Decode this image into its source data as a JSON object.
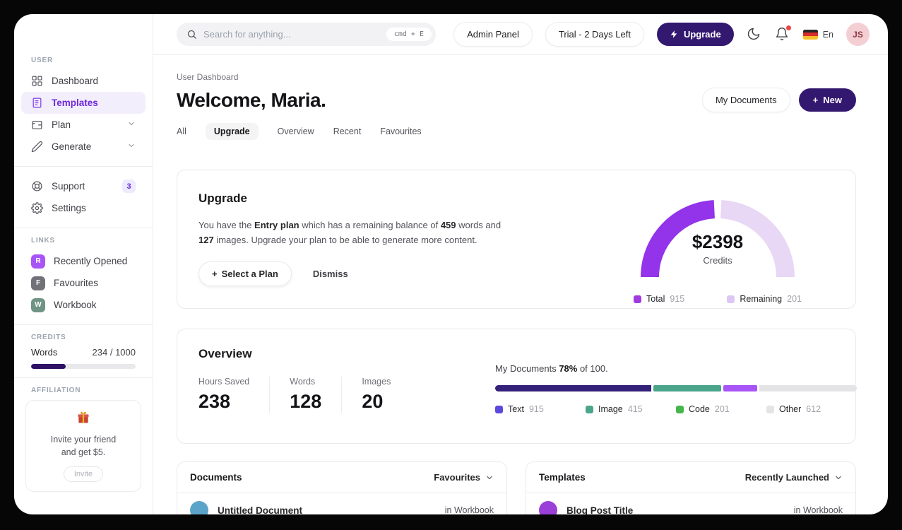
{
  "sidebar": {
    "section_labels": {
      "user": "USER",
      "links": "LINKS",
      "credits": "CREDITS",
      "affiliation": "AFFILIATION"
    },
    "nav": [
      {
        "label": "Dashboard",
        "icon": "dashboard-grid-icon",
        "active": false
      },
      {
        "label": "Templates",
        "icon": "templates-doc-icon",
        "active": true
      },
      {
        "label": "Plan",
        "icon": "wallet-icon",
        "expandable": true
      },
      {
        "label": "Generate",
        "icon": "pencil-icon",
        "expandable": true
      }
    ],
    "secondary": [
      {
        "label": "Support",
        "icon": "lifebuoy-icon",
        "badge": "3"
      },
      {
        "label": "Settings",
        "icon": "gear-icon"
      }
    ],
    "links": [
      {
        "initial": "R",
        "label": "Recently Opened",
        "color": "#a855f7"
      },
      {
        "initial": "F",
        "label": "Favourites",
        "color": "#71717a"
      },
      {
        "initial": "W",
        "label": "Workbook",
        "color": "#6f9486"
      }
    ],
    "credits": {
      "label": "Words",
      "value": "234 / 1000",
      "fill_width": "33%",
      "fill_color": "#2e1065"
    },
    "affiliation": {
      "icon": "gift-icon",
      "text_line1": "Invite your friend",
      "text_line2": "and get $5.",
      "button": "Invite"
    }
  },
  "topbar": {
    "search": {
      "placeholder": "Search for anything...",
      "shortcut": "cmd + E",
      "icon": "search-icon"
    },
    "admin_button": "Admin Panel",
    "trial_button": "Trial - 2 Days Left",
    "upgrade_button": {
      "label": "Upgrade",
      "icon": "lightning-icon",
      "bg": "#331870"
    },
    "dark_mode_icon": "moon-icon",
    "notifications_icon": "bell-icon",
    "notification_dot_color": "#ef4444",
    "language": {
      "label": "En",
      "flag": "german-flag-icon",
      "flag_colors": [
        "#262626",
        "#d92c2c",
        "#f7bf2a"
      ]
    },
    "avatar": {
      "initials": "JS",
      "bg": "#f3cfd3",
      "fg": "#8c3a44"
    }
  },
  "header": {
    "breadcrumb": "User Dashboard",
    "title": "Welcome, Maria.",
    "my_documents_button": "My Documents",
    "new_button": {
      "plus": "+",
      "label": "New",
      "bg": "#331870"
    },
    "tabs": [
      {
        "label": "All",
        "active": false
      },
      {
        "label": "Upgrade",
        "active": true
      },
      {
        "label": "Overview",
        "active": false
      },
      {
        "label": "Recent",
        "active": false
      },
      {
        "label": "Favourites",
        "active": false
      }
    ]
  },
  "upgrade_card": {
    "title": "Upgrade",
    "body": [
      {
        "text": "You have the "
      },
      {
        "text": "Entry plan",
        "bold": true
      },
      {
        "text": " which has a remaining balance of "
      },
      {
        "text": "459",
        "bold": true
      },
      {
        "text": " words and "
      },
      {
        "text": "127",
        "bold": true
      },
      {
        "text": " images. Upgrade your plan to be able to generate more content."
      }
    ],
    "select_plan_button": {
      "plus": "+",
      "label": "Select a Plan"
    },
    "dismiss_button": "Dismiss",
    "gauge": {
      "type": "gauge",
      "amount": "$2398",
      "caption": "Credits",
      "arc_total_color": "#9333ea",
      "arc_remaining_color": "#e9d7f6",
      "legend": [
        {
          "label": "Total",
          "value": "915",
          "color": "#a13ae0"
        },
        {
          "label": "Remaining",
          "value": "201",
          "color": "#dcc7f4"
        }
      ]
    }
  },
  "overview_card": {
    "title": "Overview",
    "stats": [
      {
        "label": "Hours Saved",
        "value": "238"
      },
      {
        "label": "Words",
        "value": "128"
      },
      {
        "label": "Images",
        "value": "20"
      }
    ],
    "bar": {
      "type": "stacked-bar",
      "caption_prefix": "My Documents ",
      "caption_bold": "78%",
      "caption_suffix": " of 100.",
      "segments": [
        {
          "label": "Text",
          "value": "915",
          "pct": 44,
          "bar_color": "#33217a",
          "swatch_color": "#5b49dc"
        },
        {
          "label": "Image",
          "value": "415",
          "pct": 19,
          "bar_color": "#4ba58b",
          "swatch_color": "#4ba58b"
        },
        {
          "label": "Code",
          "value": "201",
          "pct": 9.5,
          "bar_color": "#a855f7",
          "swatch_color": "#45b649"
        },
        {
          "label": "Other",
          "value": "612",
          "pct": 27.5,
          "bar_color": "#e4e4e7",
          "swatch_color": "#e4e4e7"
        }
      ]
    }
  },
  "documents_card": {
    "title": "Documents",
    "filter": "Favourites",
    "items": [
      {
        "title": "Untitled Document",
        "location": "in Workbook",
        "avatar_color": "#5ba3c9"
      }
    ]
  },
  "templates_card": {
    "title": "Templates",
    "filter": "Recently Launched",
    "items": [
      {
        "title": "Blog Post Title",
        "location": "in Workbook",
        "avatar_color": "#9b3fd9"
      }
    ]
  }
}
